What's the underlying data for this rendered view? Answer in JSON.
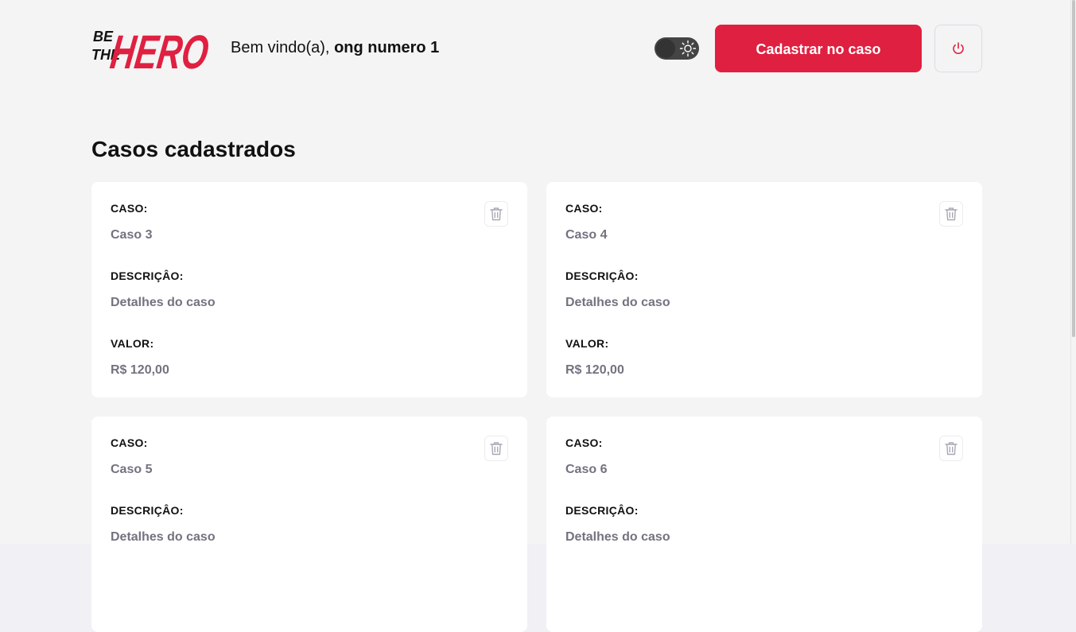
{
  "header": {
    "logo_text_line1": "BE",
    "logo_text_line2": "THE",
    "logo_text_big": "HERO",
    "welcome_prefix": "Bem vindo(a), ",
    "welcome_name": "ong numero 1",
    "theme_toggle_state": "dark",
    "register_button_label": "Cadastrar no caso",
    "logout_icon": "power-icon"
  },
  "main": {
    "title": "Casos cadastrados",
    "cases": [
      {
        "case_label": "CASO:",
        "case_value": "Caso 3",
        "description_label": "DESCRIÇÂO:",
        "description_value": "Detalhes do caso",
        "value_label": "VALOR:",
        "value_value": "R$ 120,00"
      },
      {
        "case_label": "CASO:",
        "case_value": "Caso 4",
        "description_label": "DESCRIÇÂO:",
        "description_value": "Detalhes do caso",
        "value_label": "VALOR:",
        "value_value": "R$ 120,00"
      },
      {
        "case_label": "CASO:",
        "case_value": "Caso 5",
        "description_label": "DESCRIÇÂO:",
        "description_value": "Detalhes do caso",
        "value_label": "",
        "value_value": ""
      },
      {
        "case_label": "CASO:",
        "case_value": "Caso 6",
        "description_label": "DESCRIÇÂO:",
        "description_value": "Detalhes do caso",
        "value_label": "",
        "value_value": ""
      }
    ]
  },
  "colors": {
    "brand_red": "#e02041",
    "background": "#f4f4f4",
    "muted_text": "#737380"
  }
}
